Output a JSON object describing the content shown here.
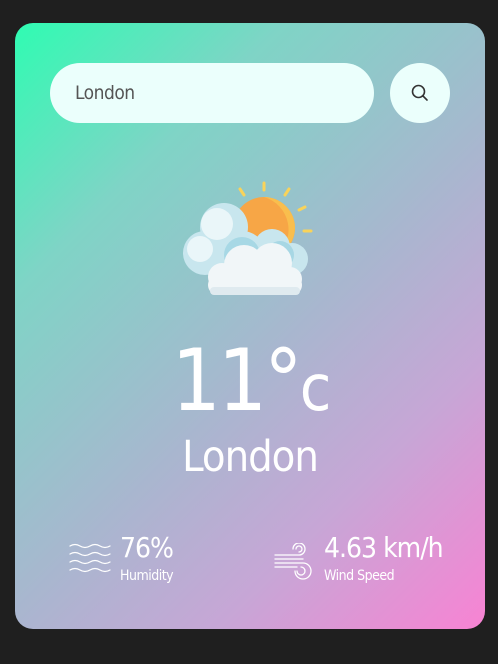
{
  "search": {
    "value": "London",
    "placeholder": "",
    "button_icon": "search-icon"
  },
  "weather": {
    "icon": "partly-cloudy-icon",
    "temperature": "11°",
    "unit": "c",
    "city": "London"
  },
  "stats": {
    "humidity": {
      "icon": "humidity-waves-icon",
      "value": "76%",
      "label": "Humidity"
    },
    "wind": {
      "icon": "wind-icon",
      "value": "4.63 km/h",
      "label": "Wind Speed"
    }
  },
  "colors": {
    "gradient_start": "#2ffcb2",
    "gradient_end": "#f883d3",
    "input_background": "#ebfffc",
    "text": "#ffffff",
    "page_background": "#1f1f1f"
  }
}
